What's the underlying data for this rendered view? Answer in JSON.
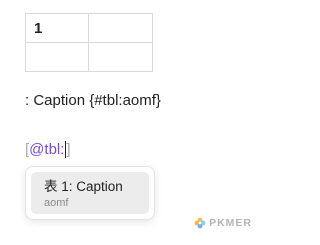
{
  "table": {
    "rows": [
      [
        "1",
        ""
      ],
      [
        "",
        ""
      ]
    ]
  },
  "caption_line": ": Caption {#tbl:aomf}",
  "reference": {
    "open_bracket": "[",
    "typed_text": "@tbl:",
    "close_bracket": "]"
  },
  "suggestion": {
    "title": "表 1:  Caption",
    "subtitle": "aomf"
  },
  "watermark": {
    "text": "PKMER",
    "logo": "pkmer-flower-logo"
  },
  "colors": {
    "reference_text": "#7b49d6",
    "bracket": "#aaaaaa",
    "suggestion_highlight": "#ececec"
  }
}
